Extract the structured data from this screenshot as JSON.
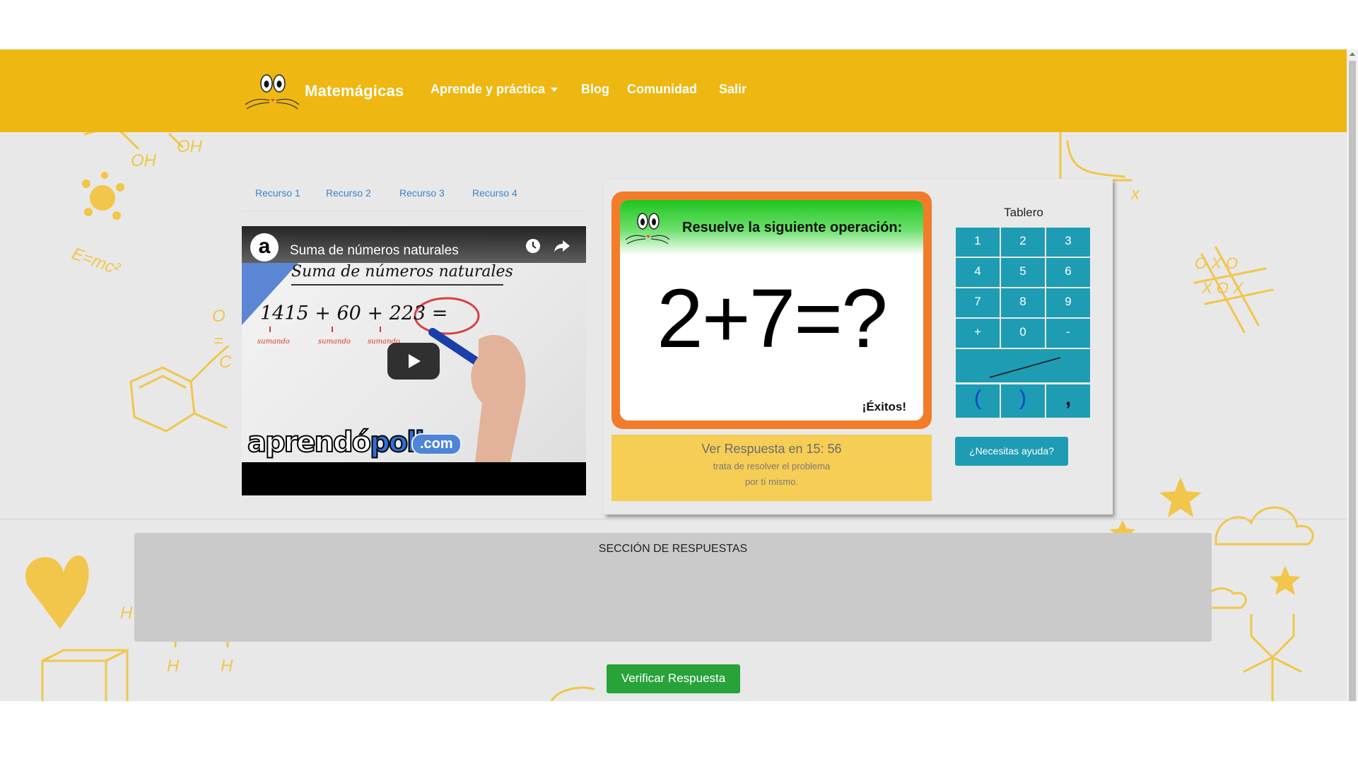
{
  "header": {
    "brand": "Matemágicas",
    "nav": [
      {
        "label": "Aprende y práctica",
        "has_dropdown": true
      },
      {
        "label": "Blog"
      },
      {
        "label": "Comunidad"
      },
      {
        "label": "Salir"
      }
    ]
  },
  "tabs": [
    "Recurso 1",
    "Recurso 2",
    "Recurso 3",
    "Recurso 4"
  ],
  "video": {
    "channel_icon": "a",
    "title": "Suma de números naturales",
    "board_title": "Suma de números naturales",
    "board_equation": "1415 + 60 + 223 =",
    "board_labels": [
      "sumando",
      "sumando",
      "sumando"
    ],
    "logo_part1": "aprendó",
    "logo_part2": "polis",
    "logo_suffix": ".com",
    "icons": [
      "channel-logo-icon",
      "watch-later-icon",
      "share-icon",
      "play-icon"
    ]
  },
  "problem": {
    "instruction": "Resuelve la siguiente operación:",
    "expression": "2+7=?",
    "good_luck": "¡Éxitos!"
  },
  "timer": {
    "text": "Ver Respuesta en 15: 56",
    "hint_line1": "trata de resolver el problema",
    "hint_line2": "por tí mismo."
  },
  "keyboard": {
    "title": "Tablero",
    "keys": [
      "1",
      "2",
      "3",
      "4",
      "5",
      "6",
      "7",
      "8",
      "9",
      "+",
      "0",
      "-"
    ],
    "fraction_key": "fraction-bar-icon",
    "open_paren": "(",
    "close_paren": ")",
    "comma": ","
  },
  "help_button": "¿Necesitas ayuda?",
  "answers": {
    "title": "SECCIÓN DE RESPUESTAS"
  },
  "verify_button": "Verificar Respuesta",
  "colors": {
    "header": "#eeb711",
    "key": "#1e9cb3",
    "card_border": "#f27c2a",
    "timer": "#f6cd55",
    "verify": "#28a33a",
    "answers_bg": "#cacaca"
  }
}
